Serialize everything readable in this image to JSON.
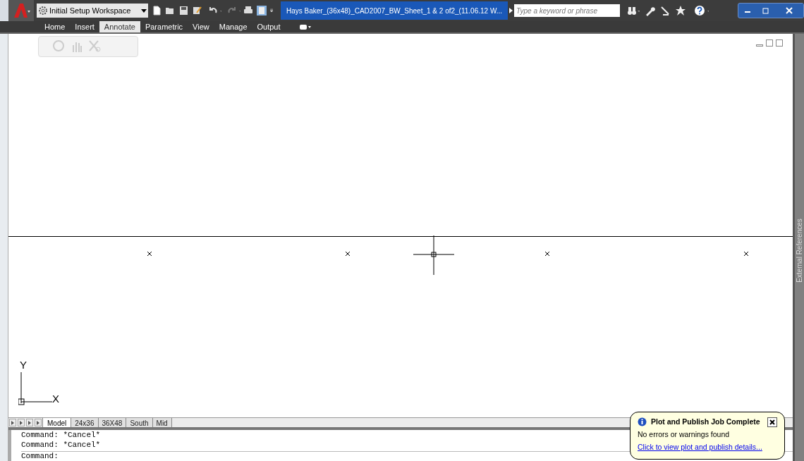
{
  "workspace": {
    "value": "Initial Setup Workspace"
  },
  "title": "Hays Baker_(36x48)_CAD2007_BW_Sheet_1 & 2 of2_(11.06.12 W...",
  "search": {
    "placeholder": "Type a keyword or phrase"
  },
  "ribbon_tabs": [
    {
      "label": "Home",
      "selected": false
    },
    {
      "label": "Insert",
      "selected": false
    },
    {
      "label": "Annotate",
      "selected": true
    },
    {
      "label": "Parametric",
      "selected": false
    },
    {
      "label": "View",
      "selected": false
    },
    {
      "label": "Manage",
      "selected": false
    },
    {
      "label": "Output",
      "selected": false
    }
  ],
  "ucs": {
    "y_label": "Y",
    "x_label": "X"
  },
  "layout_tabs": [
    {
      "label": "Model",
      "selected": true
    },
    {
      "label": "24x36",
      "selected": false
    },
    {
      "label": "36X48",
      "selected": false
    },
    {
      "label": "South",
      "selected": false
    },
    {
      "label": "Mid",
      "selected": false
    }
  ],
  "command_history": [
    "Command: *Cancel*",
    "Command: *Cancel*"
  ],
  "command_prompt": "Command:",
  "notification": {
    "title": "Plot and Publish Job Complete",
    "message": "No errors or warnings found",
    "link": "Click to view plot and publish details..."
  },
  "palette": {
    "title": "External References"
  }
}
